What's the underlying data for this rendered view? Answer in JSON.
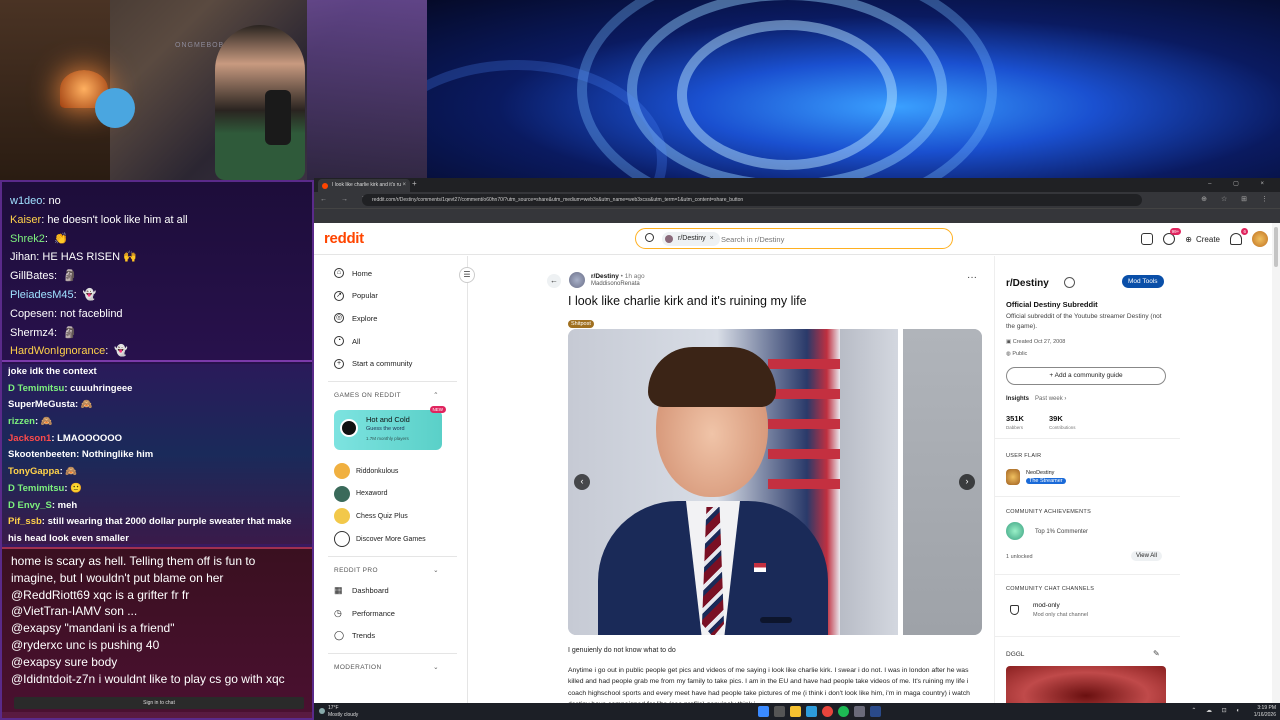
{
  "stream_chat": {
    "top": [
      {
        "user": "w1deo",
        "color": "#9fe0ff",
        "text": "no",
        "emote": ""
      },
      {
        "user": "Kaiser",
        "color": "#ffd24a",
        "text": "he doesn't look like him at all",
        "emote": ""
      },
      {
        "user": "Shrek2",
        "color": "#7df17d",
        "text": "",
        "emote": "👏"
      },
      {
        "user": "Jihan",
        "color": "#ffffff",
        "text": "HE HAS RISEN",
        "emote": "🙌"
      },
      {
        "user": "GillBates",
        "color": "#ffffff",
        "text": "",
        "emote": "🗿"
      },
      {
        "user": "PleiadesM45",
        "color": "#9fe0ff",
        "text": "",
        "emote": "👻"
      },
      {
        "user": "Copesen",
        "color": "#ffffff",
        "text": "not faceblind",
        "emote": ""
      },
      {
        "user": "Shermz4",
        "color": "#ffffff",
        "text": "",
        "emote": "🗿"
      },
      {
        "user": "HardWonIgnorance",
        "color": "#ffd24a",
        "text": "",
        "emote": "👻"
      }
    ],
    "middle": [
      {
        "user": "",
        "color": "#ffffff",
        "text": "joke idk the context"
      },
      {
        "user": "D Temimitsu",
        "color": "#7df17d",
        "text": "cuuuhringeee"
      },
      {
        "user": "SuperMeGusta",
        "color": "#ffffff",
        "text": "🙈"
      },
      {
        "user": "rizzen",
        "color": "#7df17d",
        "text": "🙈"
      },
      {
        "user": "Jackson1",
        "color": "#ff4a4a",
        "text": "LMAOOOOOO"
      },
      {
        "user": "Skootenbeeten",
        "color": "#ffffff",
        "text": "Nothinglike him"
      },
      {
        "user": "TonyGappa",
        "color": "#ffd24a",
        "text": "🙈"
      },
      {
        "user": "D Temimitsu",
        "color": "#7df17d",
        "text": "🙂"
      },
      {
        "user": "D Envy_S",
        "color": "#7df17d",
        "text": "meh"
      },
      {
        "user": "Pif_ssb",
        "color": "#ffd24a",
        "text": "still wearing that 2000 dollar purple sweater that make"
      },
      {
        "user": "",
        "color": "#ffffff",
        "text": "his head look even smaller"
      }
    ],
    "bottom": [
      "home is scary as hell. Telling them off is fun to",
      "imagine, but I wouldn't put blame on her",
      "@ReddRiott69 xqc is a grifter fr fr",
      "@VietTran-IAMV son ...",
      "@exapsy \"mandani is a friend\"",
      "@ryderxc unc is pushing 40",
      "@exapsy sure body",
      "@Ididntdoit-z7n i wouldnt like to play cs go with xqc"
    ],
    "signin_label": "Sign in to chat"
  },
  "webcam": {
    "wall_text": "ONGMEBOBE SUBS"
  },
  "browser": {
    "tab_title": "I look like charlie kirk and it's ru",
    "tab_close": "×",
    "new_tab": "+",
    "window_controls": "– ▢ ×",
    "nav_buttons": "← → ↻",
    "url": "reddit.com/r/Destiny/comments/1qevt27/comment/o60hn70/?utm_source=share&utm_medium=web3x&utm_name=web3xcss&utm_term=1&utm_content=share_button",
    "ext_icons": "⊕ ☆ ⊞ ⋮"
  },
  "reddit": {
    "logo": "reddit",
    "search": {
      "chip": "r/Destiny",
      "chip_close": "×",
      "placeholder": "Search in r/Destiny"
    },
    "header": {
      "create_label": "Create",
      "chat_badge": "99+",
      "notif_badge": "6"
    },
    "left_nav": {
      "items": [
        {
          "label": "Home",
          "icon": "⌂"
        },
        {
          "label": "Popular",
          "icon": "↗"
        },
        {
          "label": "Explore",
          "icon": "◎"
        },
        {
          "label": "All",
          "icon": "◔"
        },
        {
          "label": "Start a community",
          "icon": "+"
        }
      ],
      "games_section": "GAMES ON REDDIT",
      "featured_game": {
        "title": "Hot and Cold",
        "subtitle": "Guess the word",
        "players": "1.7M monthly players",
        "badge": "NEW"
      },
      "games": [
        {
          "label": "Riddonkulous",
          "color": "#f0b040"
        },
        {
          "label": "Hexaword",
          "color": "#3a6a5a"
        },
        {
          "label": "Chess Quiz Plus",
          "color": "#f2c84a"
        },
        {
          "label": "Discover More Games",
          "color": "#ffffff"
        }
      ],
      "pro_section": "REDDIT PRO",
      "pro_items": [
        {
          "label": "Dashboard",
          "icon": "▦"
        },
        {
          "label": "Performance",
          "icon": "◷"
        },
        {
          "label": "Trends",
          "icon": "◯"
        }
      ],
      "moderation_section": "MODERATION"
    },
    "post": {
      "subreddit": "r/Destiny",
      "time": "• 1h ago",
      "author": "MaddisonoRenata",
      "title": "I look like charlie kirk and it's ruining my life",
      "flair": "Shitpost",
      "caption": "I genuienly do not know what to do",
      "body": "Anytime i go out in public people get pics and videos of me saying i look like charlie kirk. I swear i do not. I was in london after he was killed and had people grab me from my family to take pics. I am in the EU and have had people take videos of me. It's ruining my life i coach highschool sports and every meet have had people take pictures of me (i think i don't look like him, i'm in maga country) i watch destiny have campaigned for libs (see profile) genuinely think i",
      "more": "···"
    },
    "sidebar": {
      "title": "r/Destiny",
      "mod_tools": "Mod Tools",
      "desc_title": "Official Destiny Subreddit",
      "desc": "Official subreddit of the Youtube streamer Destiny (not the game).",
      "created": "Created Oct 27, 2008",
      "visibility": "Public",
      "guide_btn": "+ Add a community guide",
      "insights": "Insights",
      "insights_period": "Past week ›",
      "stats": [
        {
          "value": "351K",
          "label": "Dabbers"
        },
        {
          "value": "39K",
          "label": "Contributions"
        }
      ],
      "user_flair_section": "USER FLAIR",
      "flair_name": "NeoDestiny",
      "flair_tag": "The Streamer",
      "achievements_section": "COMMUNITY ACHIEVEMENTS",
      "achievement": "Top 1% Commenter",
      "unlocked": "1 unlocked",
      "view_all": "View All",
      "channels_section": "COMMUNITY CHAT CHANNELS",
      "channel_name": "mod-only",
      "channel_desc": "Mod only chat channel",
      "dggl": "DGGL"
    }
  },
  "taskbar": {
    "weather_temp": "17°F",
    "weather_desc": "Mostly cloudy",
    "tray": "⌃ ☁ ⊡ ◐",
    "time": "3:19 PM",
    "date": "1/16/2026"
  }
}
